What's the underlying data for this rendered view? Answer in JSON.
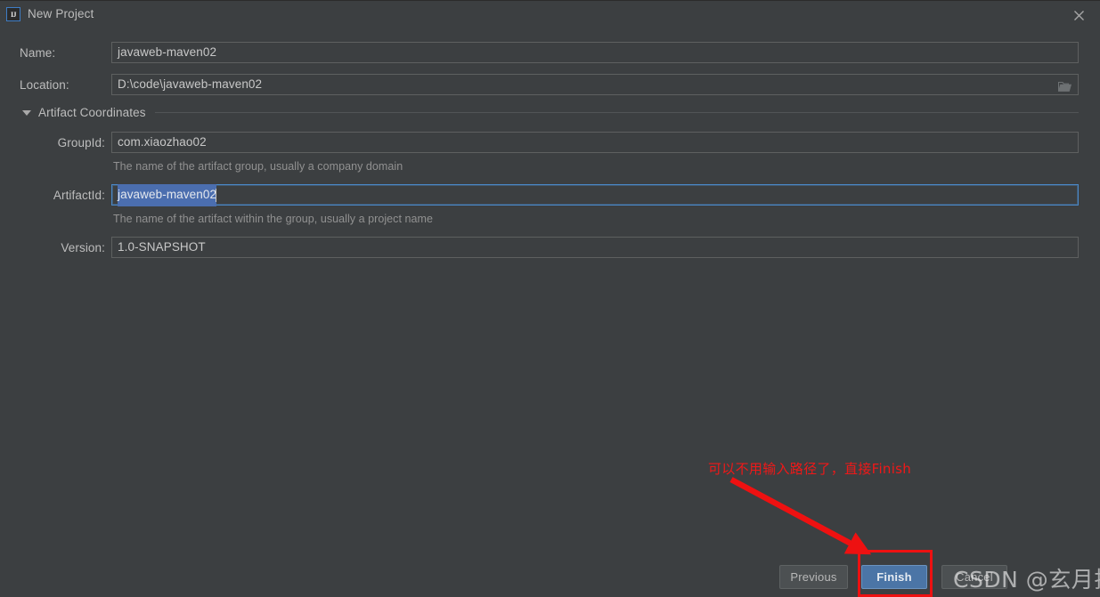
{
  "window": {
    "title": "New Project",
    "icon_label": "IJ",
    "close_icon": "close-icon",
    "background_color": "#3c3f41"
  },
  "form": {
    "fields": [
      {
        "key": "name",
        "label": "Name:",
        "value": "javaweb-maven02",
        "hint": "",
        "focused": false,
        "has_browse": false
      },
      {
        "key": "location",
        "label": "Location:",
        "value": "D:\\code\\javaweb-maven02",
        "hint": "",
        "focused": false,
        "has_browse": true,
        "browse_icon": "folder-icon"
      }
    ]
  },
  "section": {
    "title": "Artifact Coordinates",
    "expanded": true,
    "triangle_icon": "chevron-down-icon",
    "fields": [
      {
        "key": "groupid",
        "label": "GroupId:",
        "value": "com.xiaozhao02",
        "hint": "The name of the artifact group, usually a company domain",
        "focused": false
      },
      {
        "key": "artifactid",
        "label": "ArtifactId:",
        "value": "javaweb-maven02",
        "hint": "The name of the artifact within the group, usually a project name",
        "focused": true,
        "selected": true
      },
      {
        "key": "version",
        "label": "Version:",
        "value": "1.0-SNAPSHOT",
        "hint": "",
        "focused": false
      }
    ]
  },
  "footer": {
    "previous_label": "Previous",
    "finish_label": "Finish",
    "cancel_label": "Cancel"
  },
  "annotation": {
    "text": "可以不用输入路径了，直接Finish",
    "color": "#f01818",
    "arrow_color": "#ee1111",
    "highlight_target": "finish-button"
  },
  "watermark": {
    "text": "CSDN @玄月拾忆"
  }
}
